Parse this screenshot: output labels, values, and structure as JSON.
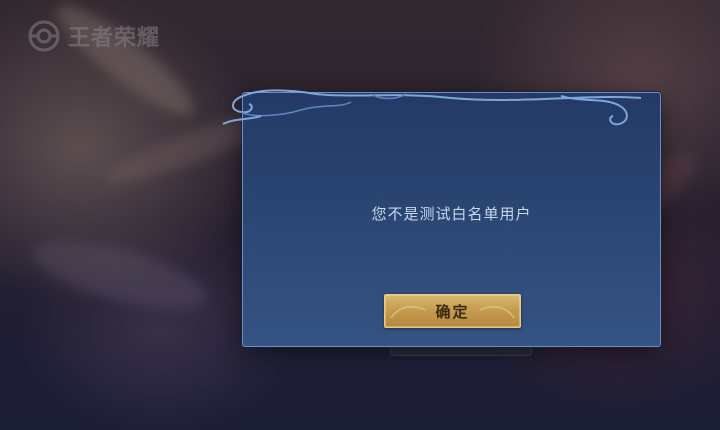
{
  "logo": {
    "text": "王者荣耀",
    "icon": "game-logo-icon"
  },
  "dialog": {
    "message": "您不是测试白名单用户",
    "confirm_label": "确定",
    "ornament_icon": "cloud-ornament-icon"
  },
  "colors": {
    "dialog_background": "#2c4875",
    "dialog_border": "#6f8fc0",
    "message_text": "#c8d6f0",
    "button_gold": "#c49a4e",
    "button_text": "#3a2a14"
  }
}
